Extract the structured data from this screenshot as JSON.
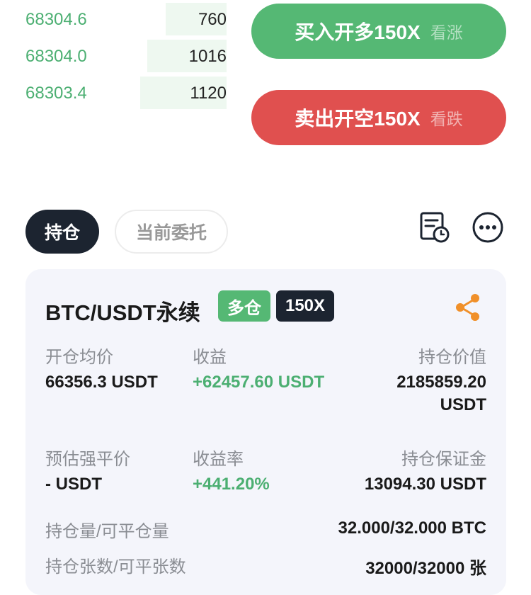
{
  "order_book": {
    "rows": [
      {
        "price": "68304.6",
        "qty": "760",
        "depth": 0.28
      },
      {
        "price": "68304.0",
        "qty": "1016",
        "depth": 0.36
      },
      {
        "price": "68303.4",
        "qty": "1120",
        "depth": 0.39
      }
    ]
  },
  "actions": {
    "buy_label": "买入开多150X",
    "buy_sub": "看涨",
    "sell_label": "卖出开空150X",
    "sell_sub": "看跌"
  },
  "tabs": {
    "positions": "持仓",
    "open_orders": "当前委托"
  },
  "position": {
    "symbol": "BTC/USDT永续",
    "side_badge": "多仓",
    "leverage_badge": "150X",
    "fields": {
      "entry_price_label": "开仓均价",
      "entry_price_value": "66356.3  USDT",
      "pnl_label": "收益",
      "pnl_value": "+62457.60  USDT",
      "position_value_label": "持仓价值",
      "position_value_line1": "2185859.20",
      "position_value_line2": "USDT",
      "liq_price_label": "预估强平价",
      "liq_price_value": "- USDT",
      "roe_label": "收益率",
      "roe_value": "+441.20%",
      "margin_label": "持仓保证金",
      "margin_value": "13094.30  USDT",
      "size_label": "持仓量/可平仓量",
      "size_value": "32.000/32.000 BTC",
      "contracts_label": "持仓张数/可平张数",
      "contracts_value": "32000/32000 张"
    }
  },
  "colors": {
    "buy": "#55b874",
    "sell": "#e0504f",
    "dark": "#1c2430",
    "share_icon": "#f0902a",
    "positive": "#4caf72"
  },
  "icons": [
    "order-history-icon",
    "more-options-icon",
    "share-icon"
  ]
}
